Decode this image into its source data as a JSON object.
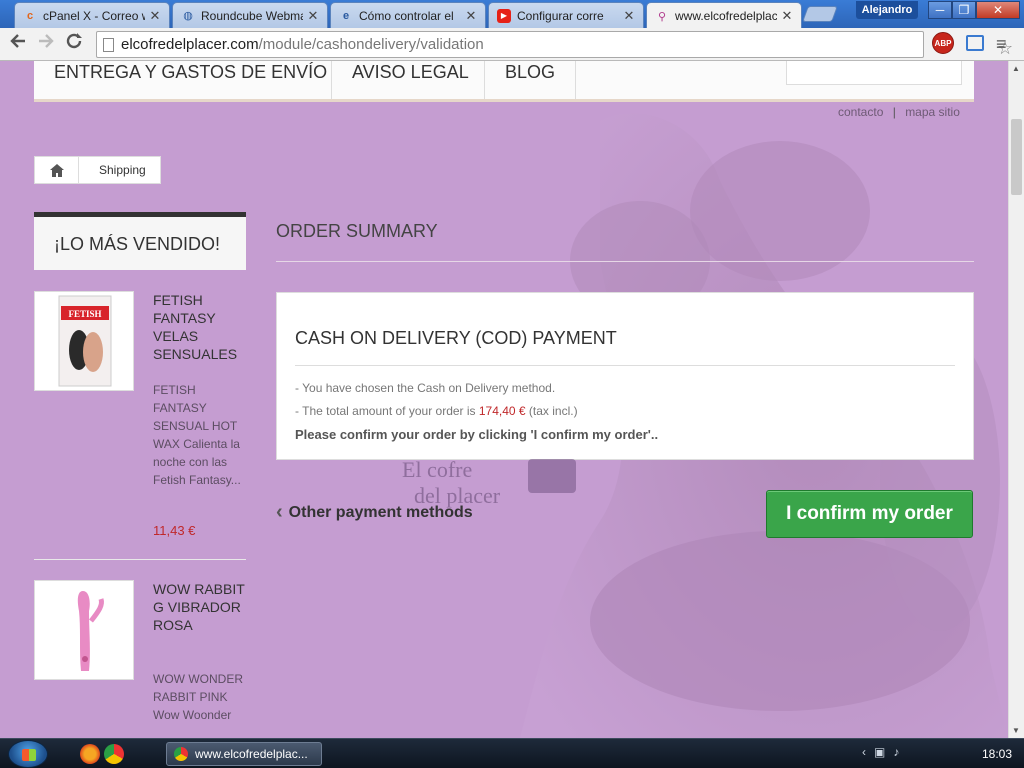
{
  "browser": {
    "tabs": [
      {
        "title": "cPanel X - Correo w",
        "icon": "cpanel-icon",
        "active": false
      },
      {
        "title": "Roundcube Webma",
        "icon": "roundcube-icon",
        "active": false
      },
      {
        "title": "Cómo controlar el",
        "icon": "ie-icon",
        "active": false
      },
      {
        "title": "Configurar corre",
        "icon": "youtube-icon",
        "active": false
      },
      {
        "title": "www.elcofredelplac",
        "icon": "site-icon",
        "active": true
      }
    ],
    "user": "Alejandro",
    "url_host": "elcofredelplacer.com",
    "url_path": "/module/cashondelivery/validation",
    "abp_label": "ABP"
  },
  "site": {
    "nav": {
      "shipping": "ENTREGA Y GASTOS DE ENVÍO",
      "legal": "AVISO LEGAL",
      "blog": "BLOG"
    },
    "toplinks": {
      "contact": "contacto",
      "sep": "|",
      "sitemap": "mapa sitio"
    },
    "breadcrumb": {
      "current": "Shipping"
    },
    "sidebar": {
      "title": "¡LO MÁS VENDIDO!",
      "products": [
        {
          "name": "FETISH FANTASY VELAS SENSUALES",
          "description": "FETISH FANTASY SENSUAL HOT WAX Calienta la noche con las Fetish Fantasy...",
          "price": "11,43 €",
          "thumb_label": "FETISH"
        },
        {
          "name": "WOW RABBIT G VIBRADOR ROSA",
          "description": "WOW WONDER RABBIT PINK Wow Woonder",
          "price": ""
        }
      ]
    },
    "order": {
      "heading": "ORDER SUMMARY",
      "box_title": "CASH ON DELIVERY (COD) PAYMENT",
      "line1": "- You have chosen the Cash on Delivery method.",
      "line2_prefix": "- The total amount of your order is ",
      "amount": "174,40 €",
      "line2_suffix": " (tax incl.)",
      "confirm_note": "Please confirm your order by clicking 'I confirm my order'..",
      "back_label": "Other payment methods",
      "confirm_label": "I confirm my order"
    },
    "watermark": {
      "line1": "El cofre",
      "line2": "del placer"
    }
  },
  "taskbar": {
    "window_title": "www.elcofredelplac...",
    "clock": "18:03"
  },
  "colors": {
    "page_bg": "#c49bd0",
    "price_red": "#c0282a",
    "confirm_green": "#3aa54a"
  }
}
